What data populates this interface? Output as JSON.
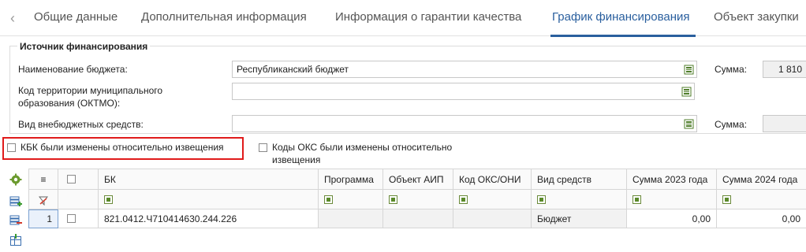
{
  "tabs": [
    {
      "label": "Общие данные",
      "active": false
    },
    {
      "label": "Дополнительная информация",
      "active": false
    },
    {
      "label": "Информация о гарантии качества",
      "active": false
    },
    {
      "label": "График финансирования",
      "active": true
    },
    {
      "label": "Объект закупки",
      "active": false
    }
  ],
  "financing": {
    "title": "Источник финансирования",
    "budget_name_label": "Наименование бюджета:",
    "budget_name_value": "Республиканский бюджет",
    "sum_label": "Сумма:",
    "sum_value": "1 810",
    "oktmo_label_line1": "Код территории муниципального",
    "oktmo_label_line2": "образования (ОКТМО):",
    "oktmo_value": "",
    "offbudget_label": "Вид внебюджетных средств:",
    "offbudget_value": "",
    "sum2_label": "Сумма:",
    "sum2_value": ""
  },
  "checks": {
    "kbk_changed": {
      "label": "КБК были изменены относительно извещения",
      "checked": false
    },
    "oks_changed": {
      "label_line1": "Коды ОКС были изменены относительно",
      "label_line2": "извещения",
      "checked": false
    }
  },
  "toolbar": {
    "icons": [
      "settings-icon",
      "add-row-icon",
      "delete-row-icon",
      "import-icon"
    ]
  },
  "grid": {
    "columns": [
      "≡",
      "",
      "БК",
      "Программа",
      "Объект АИП",
      "Код ОКС/ОНИ",
      "Вид средств",
      "Сумма 2023 года",
      "Сумма 2024 года"
    ],
    "rows": [
      {
        "num": "1",
        "bk": "821.0412.Ч710414630.244.226",
        "program": "",
        "aip": "",
        "oks": "",
        "funds": "Бюджет",
        "sum2023": "0,00",
        "sum2024": "0,00"
      }
    ]
  },
  "colors": {
    "accent": "#2a5f9e",
    "highlight": "#e01b1b"
  }
}
